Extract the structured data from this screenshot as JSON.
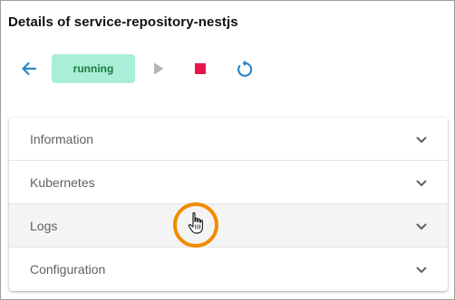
{
  "header": {
    "title": "Details of service-repository-nestjs"
  },
  "toolbar": {
    "back_icon": "arrow-left-icon",
    "status": "running",
    "play_icon": "play-icon",
    "stop_icon": "stop-icon",
    "restart_icon": "restart-icon"
  },
  "panels": [
    {
      "label": "Information",
      "expanded": false
    },
    {
      "label": "Kubernetes",
      "expanded": false
    },
    {
      "label": "Logs",
      "expanded": false
    },
    {
      "label": "Configuration",
      "expanded": false
    }
  ],
  "colors": {
    "accent": "#2b87c8",
    "status_bg": "#a8eed8",
    "status_text": "#1b7a3c",
    "stop": "#e8174b",
    "highlight": "#f08c00"
  }
}
